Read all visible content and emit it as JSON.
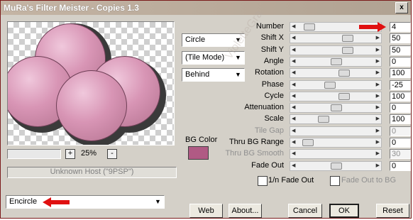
{
  "window": {
    "title": "MuRa's Filter Meister - Copies 1.3",
    "close_glyph": "x"
  },
  "preview": {
    "zoom_minus": "-",
    "zoom_plus": "+",
    "zoom_value": "25%",
    "host_text": "Unknown Host (\"9PSP\")",
    "watermark": "VioletteGra"
  },
  "selects": {
    "shape": "Circle",
    "tile_mode": "(Tile Mode)",
    "placement": "Behind",
    "preset": "Encircle"
  },
  "bg_color": {
    "label": "BG Color",
    "color": "#b05a84"
  },
  "params": [
    {
      "label": "Number",
      "value": "4",
      "level": 0.08,
      "enabled": true
    },
    {
      "label": "Shift X",
      "value": "50",
      "level": 0.68,
      "enabled": true
    },
    {
      "label": "Shift Y",
      "value": "50",
      "level": 0.68,
      "enabled": true
    },
    {
      "label": "Angle",
      "value": "0",
      "level": 0.5,
      "enabled": true
    },
    {
      "label": "Rotation",
      "value": "100",
      "level": 0.62,
      "enabled": true
    },
    {
      "label": "Phase",
      "value": "-25",
      "level": 0.4,
      "enabled": true
    },
    {
      "label": "Cycle",
      "value": "100",
      "level": 0.62,
      "enabled": true
    },
    {
      "label": "Attenuation",
      "value": "0",
      "level": 0.5,
      "enabled": true
    },
    {
      "label": "Scale",
      "value": "100",
      "level": 0.3,
      "enabled": true
    },
    {
      "label": "Tile Gap",
      "value": "0",
      "level": null,
      "enabled": false
    },
    {
      "label": "Thru BG Range",
      "value": "0",
      "level": 0.05,
      "enabled": true
    },
    {
      "label": "Thru BG Smooth",
      "value": "30",
      "level": null,
      "enabled": false
    },
    {
      "label": "Fade Out",
      "value": "0",
      "level": 0.5,
      "enabled": true
    }
  ],
  "checkboxes": {
    "one_n_fade_out": "1/n Fade Out",
    "fade_out_to_bg": "Fade Out to BG"
  },
  "buttons": {
    "web": "Web",
    "about": "About...",
    "cancel": "Cancel",
    "ok": "OK",
    "reset": "Reset"
  },
  "colors": {
    "accent_arrow": "#e01010",
    "circle_pink": "#d895b5",
    "dialog_bg": "#d4d0c8"
  }
}
